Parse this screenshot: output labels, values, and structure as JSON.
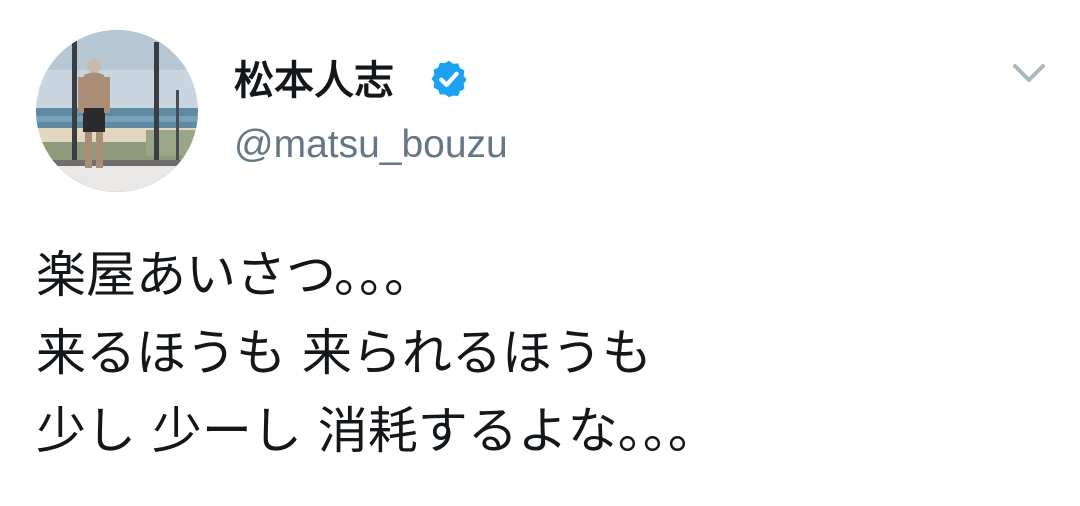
{
  "author": {
    "display_name": "松本人志",
    "handle": "@matsu_bouzu",
    "verified": true
  },
  "icons": {
    "verified": "verified-badge-icon",
    "menu": "chevron-down-icon"
  },
  "tweet": {
    "lines": [
      "楽屋あいさつ。。。",
      "来るほうも 来られるほうも",
      "少し 少ーし 消耗するよな。。。"
    ]
  },
  "colors": {
    "text": "#14171a",
    "handle": "#657786",
    "verified": "#1da1f2",
    "caret": "#aab8c2"
  }
}
